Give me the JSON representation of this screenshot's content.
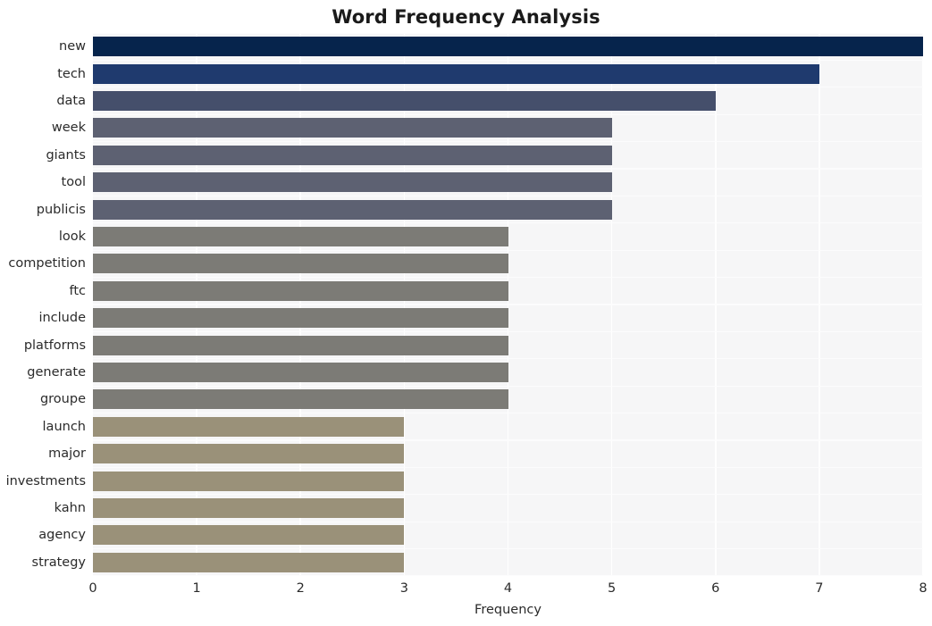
{
  "chart_data": {
    "type": "bar",
    "orientation": "horizontal",
    "title": "Word Frequency Analysis",
    "xlabel": "Frequency",
    "ylabel": "",
    "xlim": [
      0,
      8
    ],
    "xticks": [
      0,
      1,
      2,
      3,
      4,
      5,
      6,
      7,
      8
    ],
    "xtick_labels": [
      "0",
      "1",
      "2",
      "3",
      "4",
      "5",
      "6",
      "7",
      "8"
    ],
    "grid": true,
    "legend": false,
    "categories": [
      "new",
      "tech",
      "data",
      "week",
      "giants",
      "tool",
      "publicis",
      "look",
      "competition",
      "ftc",
      "include",
      "platforms",
      "generate",
      "groupe",
      "launch",
      "major",
      "investments",
      "kahn",
      "agency",
      "strategy"
    ],
    "values": [
      8,
      7,
      6,
      5,
      5,
      5,
      5,
      4,
      4,
      4,
      4,
      4,
      4,
      4,
      3,
      3,
      3,
      3,
      3,
      3
    ],
    "bar_colors": [
      "#06244c",
      "#1f3a6e",
      "#454f6b",
      "#5d6172",
      "#5d6172",
      "#5d6172",
      "#5d6172",
      "#7c7b76",
      "#7c7b76",
      "#7c7b76",
      "#7c7b76",
      "#7c7b76",
      "#7c7b76",
      "#7c7b76",
      "#9a9179",
      "#9a9179",
      "#9a9179",
      "#9a9179",
      "#9a9179",
      "#9a9179"
    ],
    "plot_background": "#f6f6f7",
    "figure_background": "#ffffff",
    "gridline_color": "#ffffff"
  }
}
